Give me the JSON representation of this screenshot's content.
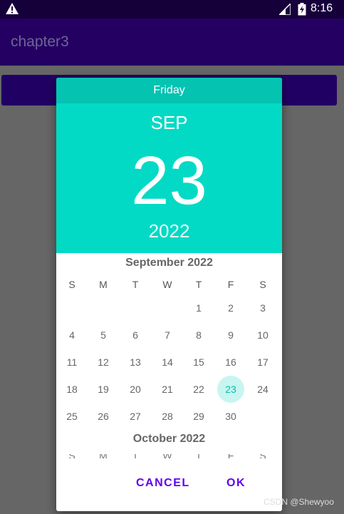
{
  "status_bar": {
    "time": "8:16"
  },
  "app": {
    "title": "chapter3"
  },
  "date_picker": {
    "header": {
      "day_name": "Friday",
      "month": "SEP",
      "day": "23",
      "year": "2022"
    },
    "months": [
      {
        "title": "September 2022",
        "weekdays": [
          "S",
          "M",
          "T",
          "W",
          "T",
          "F",
          "S"
        ],
        "weeks": [
          [
            "",
            "",
            "",
            "",
            "1",
            "2",
            "3"
          ],
          [
            "4",
            "5",
            "6",
            "7",
            "8",
            "9",
            "10"
          ],
          [
            "11",
            "12",
            "13",
            "14",
            "15",
            "16",
            "17"
          ],
          [
            "18",
            "19",
            "20",
            "21",
            "22",
            "23",
            "24"
          ],
          [
            "25",
            "26",
            "27",
            "28",
            "29",
            "30",
            ""
          ]
        ],
        "selected_day": "23"
      },
      {
        "title": "October 2022"
      }
    ],
    "buttons": {
      "cancel": "CANCEL",
      "ok": "OK"
    }
  },
  "watermark": "CSDN @Shewyoo",
  "colors": {
    "accent": "#03dac5",
    "primary": "#6200ee",
    "status_bar": "#16003a"
  }
}
